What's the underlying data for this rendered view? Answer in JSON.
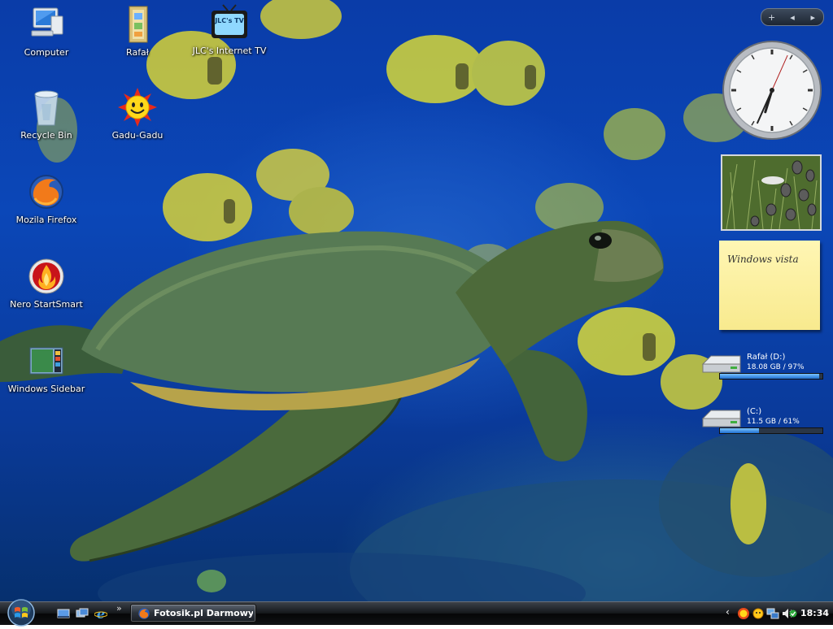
{
  "desktop": {
    "icons": [
      {
        "label": "Computer",
        "icon": "computer-icon"
      },
      {
        "label": "Rafał",
        "icon": "user-folder-icon"
      },
      {
        "label": "JLC's Internet TV",
        "icon": "tv-icon",
        "glyph_text": "JLC's TV"
      },
      {
        "label": "Recycle Bin",
        "icon": "recycle-bin-icon"
      },
      {
        "label": "Gadu-Gadu",
        "icon": "sun-smiley-icon"
      },
      {
        "label": "Mozila Firefox",
        "icon": "firefox-icon"
      },
      {
        "label": "Nero StartSmart",
        "icon": "nero-icon"
      },
      {
        "label": "Windows Sidebar",
        "icon": "windows-sidebar-icon"
      }
    ]
  },
  "sidebar": {
    "controls": {
      "add": "+",
      "prev": "◂",
      "next": "▸"
    },
    "clock": {
      "hour": 6,
      "minute": 34,
      "second": 4
    },
    "notes": {
      "text": "Windows vista"
    },
    "drives": [
      {
        "name": "Rafał (D:)",
        "size": "18.08 GB / 97%",
        "percent": 97
      },
      {
        "name": "(C:)",
        "size": "11.5 GB / 61%",
        "percent": 38
      }
    ]
  },
  "taskbar": {
    "quick_launch": [
      "show-desktop-icon",
      "switch-windows-icon",
      "internet-explorer-icon"
    ],
    "ql_chevron": "»",
    "window_button": {
      "label": "Fotosik.pl Darmowy ...",
      "icon": "firefox-icon"
    },
    "tray": {
      "chevron": "‹",
      "icons": [
        "gadu-gadu-tray-icon",
        "sun-tray-icon",
        "network-icon",
        "volume-icon",
        "security-icon"
      ],
      "time": "18:34"
    }
  },
  "colors": {
    "water": "#0b47b8",
    "note": "#fff6b4",
    "drive_fill": "#1f6fd0"
  }
}
